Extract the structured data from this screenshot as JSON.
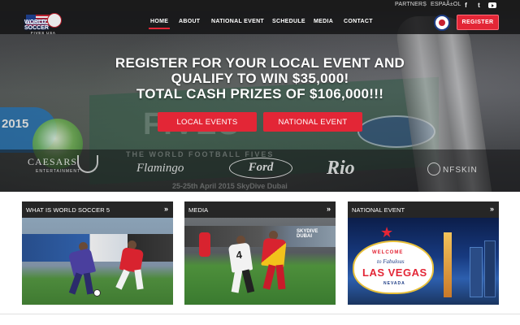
{
  "topbar": {
    "partners": "PARTNERS",
    "language": "ESPAÃ±OL",
    "social_icons": [
      "facebook-icon",
      "twitter-icon",
      "youtube-icon"
    ]
  },
  "logo": {
    "line1": "WORLD",
    "line2": "SOCCER",
    "sub": "FIVES USA"
  },
  "nav": {
    "items": [
      {
        "label": "HOME",
        "active": true
      },
      {
        "label": "ABOUT",
        "active": false
      },
      {
        "label": "NATIONAL EVENT",
        "active": false
      },
      {
        "label": "SCHEDULE",
        "active": false
      },
      {
        "label": "MEDIA",
        "active": false
      },
      {
        "label": "CONTACT",
        "active": false
      }
    ],
    "register_label": "REGISTER"
  },
  "hero": {
    "headline_line1": "REGISTER FOR YOUR LOCAL EVENT AND",
    "headline_line2": "QUALIFY TO WIN $35,000!",
    "headline_line3": "TOTAL CASH PRIZES OF $106,000!!!",
    "cta_local": "LOCAL EVENTS",
    "cta_national": "NATIONAL EVENT",
    "sponsors": {
      "caesars": "CAESARS",
      "caesars_sub": "ENTERTAINMENT",
      "flamingo": "Flamingo",
      "ford": "Ford",
      "rio": "Rio",
      "nfskin": "NFSKIN"
    },
    "backdrop_text": {
      "wfc": "THE WORLD FOOTBALL FIVES",
      "date": "25-25th April 2015 SkyDive Dubai",
      "badge": "2015",
      "fives": "FIVES"
    }
  },
  "cards": [
    {
      "title": "WHAT IS WORLD SOCCER 5",
      "arrow": "»"
    },
    {
      "title": "MEDIA",
      "arrow": "»"
    },
    {
      "title": "NATIONAL EVENT",
      "arrow": "»"
    }
  ],
  "media_photo": {
    "sign_line1": "SKYDIVE",
    "sign_line2": "DUBAI",
    "player_number": "4"
  },
  "vegas_sign": {
    "welcome": "WELCOME",
    "to": "to Fabulous",
    "city": "LAS VEGAS",
    "state": "NEVADA"
  },
  "colors": {
    "accent": "#e32636",
    "nav_bg": "#121214",
    "card_head": "#262626"
  }
}
